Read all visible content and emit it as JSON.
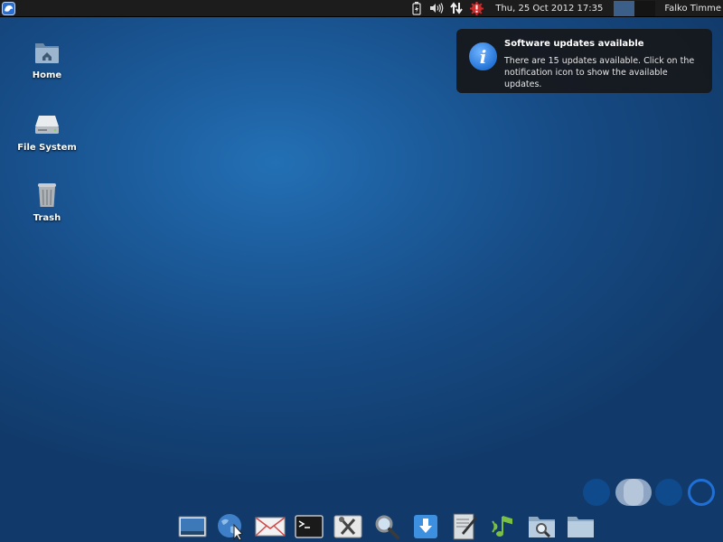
{
  "top_panel": {
    "menu_icon": "xfce-menu-icon",
    "tray_icons": [
      "battery-icon",
      "volume-icon",
      "network-icon",
      "update-notifier-icon"
    ],
    "clock": "Thu, 25 Oct 2012 17:35",
    "workspaces": [
      "workspace-1",
      "workspace-2"
    ],
    "user": "Falko Timme"
  },
  "desktop": {
    "icons": [
      {
        "label": "Home",
        "icon": "home-folder-icon"
      },
      {
        "label": "File System",
        "icon": "hard-drive-icon"
      },
      {
        "label": "Trash",
        "icon": "trash-icon"
      }
    ]
  },
  "notification": {
    "title": "Software updates available",
    "body": "There are 15 updates available. Click on the notification icon to show the available updates.",
    "icon": "info-icon"
  },
  "dock": {
    "items": [
      "show-desktop-icon",
      "web-browser-icon",
      "mail-icon",
      "terminal-icon",
      "settings-icon",
      "search-icon",
      "download-icon",
      "text-editor-icon",
      "music-player-icon",
      "file-search-icon",
      "file-manager-icon"
    ]
  },
  "colors": {
    "background": "#1c5c9c",
    "panel": "#1c1c1c",
    "notification_bg": "#16181c",
    "accent": "#2474d6"
  }
}
